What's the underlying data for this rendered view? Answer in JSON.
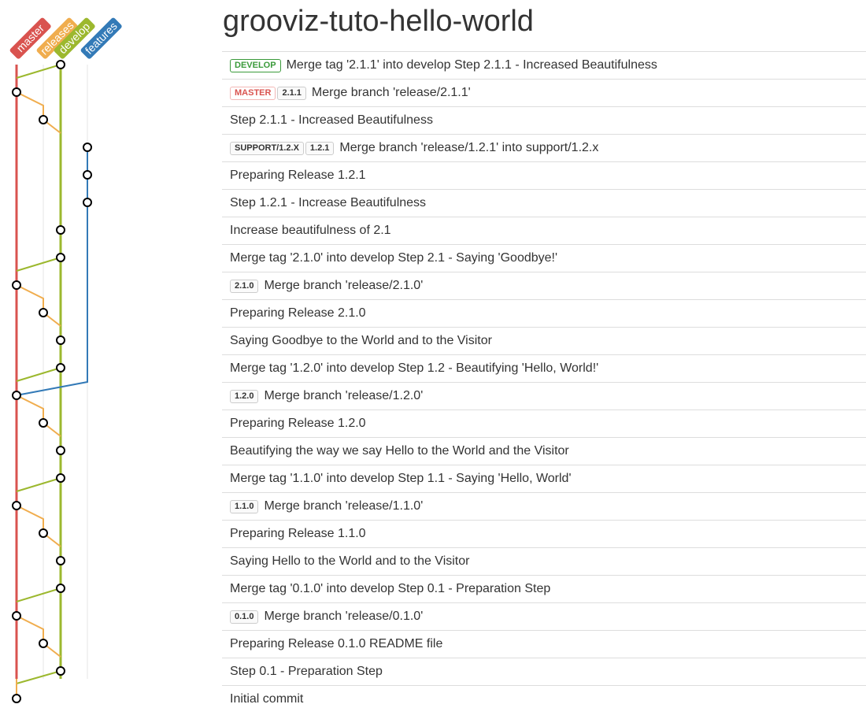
{
  "page": {
    "title": "grooviz-tuto-hello-world"
  },
  "colors": {
    "master": "#d9534f",
    "releases": "#f0ad4e",
    "develop": "#9cb82e",
    "features": "#337ab7",
    "support": "#cccccc"
  },
  "lanes": [
    {
      "name": "master",
      "label": "master"
    },
    {
      "name": "releases",
      "label": "releases"
    },
    {
      "name": "develop",
      "label": "develop"
    },
    {
      "name": "features",
      "label": "features"
    }
  ],
  "commits": [
    {
      "message": "Merge tag '2.1.1' into develop Step 2.1.1 - Increased Beautifulness",
      "lane": "develop",
      "tags": [
        {
          "text": "DEVELOP",
          "kind": "develop"
        }
      ]
    },
    {
      "message": "Merge branch 'release/2.1.1'",
      "lane": "master",
      "tags": [
        {
          "text": "MASTER",
          "kind": "master"
        },
        {
          "text": "2.1.1",
          "kind": "version"
        }
      ]
    },
    {
      "message": "Step 2.1.1 - Increased Beautifulness",
      "lane": "releases",
      "tags": []
    },
    {
      "message": "Merge branch 'release/1.2.1' into support/1.2.x",
      "lane": "features",
      "tags": [
        {
          "text": "SUPPORT/1.2.X",
          "kind": "support"
        },
        {
          "text": "1.2.1",
          "kind": "version"
        }
      ]
    },
    {
      "message": "Preparing Release 1.2.1",
      "lane": "features",
      "tags": []
    },
    {
      "message": "Step 1.2.1 - Increase Beautifulness",
      "lane": "features",
      "tags": []
    },
    {
      "message": "Increase beautifulness of 2.1",
      "lane": "develop",
      "tags": []
    },
    {
      "message": "Merge tag '2.1.0' into develop Step 2.1 - Saying 'Goodbye!'",
      "lane": "develop",
      "tags": []
    },
    {
      "message": "Merge branch 'release/2.1.0'",
      "lane": "master",
      "tags": [
        {
          "text": "2.1.0",
          "kind": "version"
        }
      ]
    },
    {
      "message": "Preparing Release 2.1.0",
      "lane": "releases",
      "tags": []
    },
    {
      "message": "Saying Goodbye to the World and to the Visitor",
      "lane": "develop",
      "tags": []
    },
    {
      "message": "Merge tag '1.2.0' into develop Step 1.2 - Beautifying 'Hello, World!'",
      "lane": "develop",
      "tags": []
    },
    {
      "message": "Merge branch 'release/1.2.0'",
      "lane": "master",
      "tags": [
        {
          "text": "1.2.0",
          "kind": "version"
        }
      ]
    },
    {
      "message": "Preparing Release 1.2.0",
      "lane": "releases",
      "tags": []
    },
    {
      "message": "Beautifying the way we say Hello to the World and the Visitor",
      "lane": "develop",
      "tags": []
    },
    {
      "message": "Merge tag '1.1.0' into develop Step 1.1 - Saying 'Hello, World'",
      "lane": "develop",
      "tags": []
    },
    {
      "message": "Merge branch 'release/1.1.0'",
      "lane": "master",
      "tags": [
        {
          "text": "1.1.0",
          "kind": "version"
        }
      ]
    },
    {
      "message": "Preparing Release 1.1.0",
      "lane": "releases",
      "tags": []
    },
    {
      "message": "Saying Hello to the World and to the Visitor",
      "lane": "develop",
      "tags": []
    },
    {
      "message": "Merge tag '0.1.0' into develop Step 0.1 - Preparation Step",
      "lane": "develop",
      "tags": []
    },
    {
      "message": "Merge branch 'release/0.1.0'",
      "lane": "master",
      "tags": [
        {
          "text": "0.1.0",
          "kind": "version"
        }
      ]
    },
    {
      "message": "Preparing Release 0.1.0 README file",
      "lane": "releases",
      "tags": []
    },
    {
      "message": "Step 0.1 - Preparation Step",
      "lane": "develop",
      "tags": []
    },
    {
      "message": "Initial commit",
      "lane": "master",
      "tags": []
    }
  ]
}
